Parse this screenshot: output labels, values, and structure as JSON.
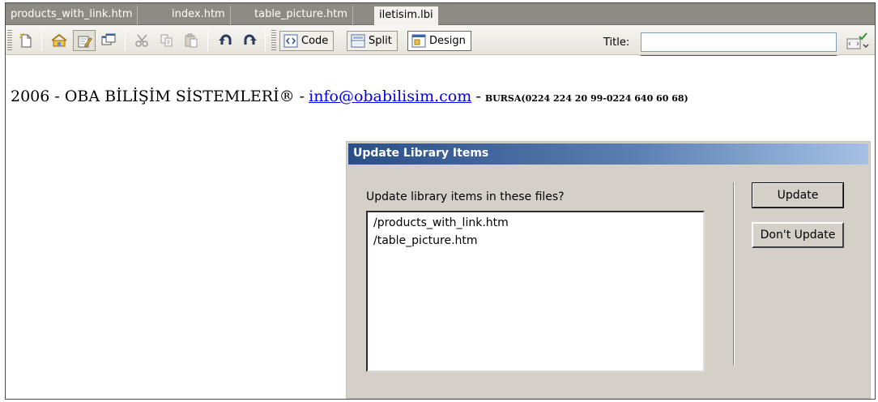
{
  "tabs": [
    {
      "label": "products_with_link.htm",
      "active": false
    },
    {
      "label": "index.htm",
      "active": false
    },
    {
      "label": "table_picture.htm",
      "active": false
    },
    {
      "label": "iletisim.lbi",
      "active": true
    }
  ],
  "toolbar": {
    "icons": [
      "new-document-icon",
      "home-icon",
      "edit-icon",
      "window-icon",
      "cut-icon",
      "copy-icon",
      "paste-icon",
      "undo-icon",
      "redo-icon"
    ],
    "views": [
      {
        "label": "Code",
        "icon": "code-view-icon",
        "active": false
      },
      {
        "label": "Split",
        "icon": "split-view-icon",
        "active": false
      },
      {
        "label": "Design",
        "icon": "design-view-icon",
        "active": true
      }
    ],
    "title_label": "Title:",
    "title_value": "",
    "validate_icon": "validate-icon"
  },
  "content": {
    "copyright": "2006 - OBA BİLİŞİM SİSTEMLERİ® -",
    "email": "info@obabilisim.com",
    "separator": "-",
    "contact": "BURSA(0224 224 20 99-0224 640 60 68)"
  },
  "dialog": {
    "title": "Update Library Items",
    "prompt": "Update library items in these files?",
    "files": [
      "/products_with_link.htm",
      "/table_picture.htm"
    ],
    "update_label": "Update",
    "dont_update_label": "Don't Update"
  },
  "colors": {
    "tabbar": "#8e8a84",
    "dialog_bg": "#d4d0c8",
    "titlebar_start": "#2a4e86",
    "titlebar_end": "#a6c1e4",
    "link": "#0000ee"
  }
}
